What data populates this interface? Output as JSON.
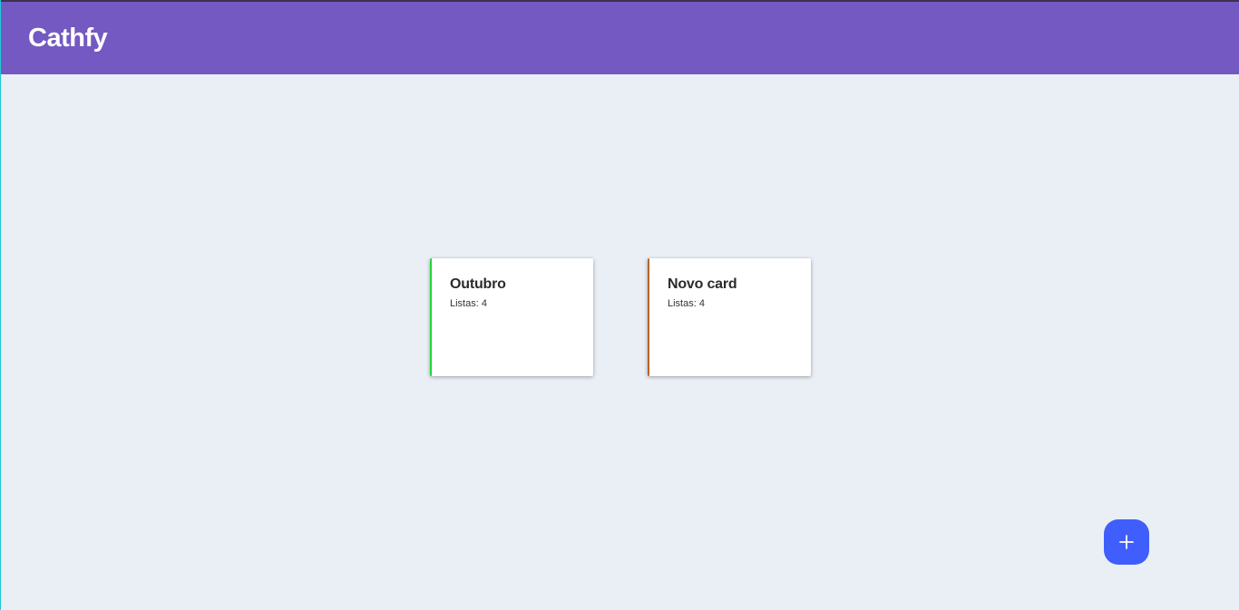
{
  "header": {
    "title": "Cathfy"
  },
  "cards": [
    {
      "title": "Outubro",
      "lists_label": "Listas: 4",
      "accent_color": "#22d33a"
    },
    {
      "title": "Novo card",
      "lists_label": "Listas: 4",
      "accent_color": "#b5652a"
    }
  ],
  "fab": {
    "icon": "plus-icon"
  },
  "colors": {
    "header_bg": "#7359c1",
    "page_bg": "#eaeff6",
    "fab_bg": "#3f5efb"
  }
}
